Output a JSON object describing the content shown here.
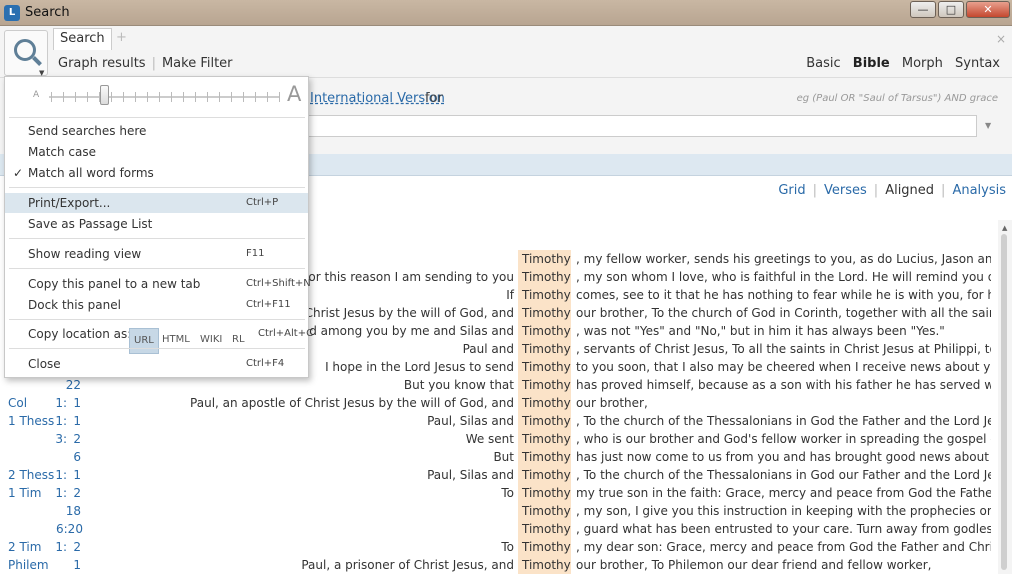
{
  "window": {
    "title": "Search",
    "app_icon": "L",
    "min": "—",
    "max": "□",
    "close": "✕"
  },
  "panel": {
    "tab": "Search",
    "add_tab": "+",
    "close": "×",
    "links": [
      "Graph results",
      "Make Filter"
    ],
    "modes": [
      "Basic",
      "Bible",
      "Morph",
      "Syntax"
    ],
    "active_mode": "Bible"
  },
  "search": {
    "version": "International Version",
    "for": "for",
    "hint": "eg (Paul OR \"Saul of Tarsus\") AND grace",
    "query": "",
    "dropdown": "▼"
  },
  "views": {
    "items": [
      "Grid",
      "Verses",
      "Aligned",
      "Analysis"
    ],
    "active": "Aligned"
  },
  "menu": {
    "slider_small": "A",
    "slider_big": "A",
    "send_here": "Send searches here",
    "match_case": "Match case",
    "match_all": "Match all word forms",
    "checkmark": "✓",
    "print": "Print/Export...",
    "print_sc": "Ctrl+P",
    "save_list": "Save as Passage List",
    "reading": "Show reading view",
    "reading_sc": "F11",
    "copy_tab": "Copy this panel to a new tab",
    "copy_tab_sc": "Ctrl+Shift+N",
    "dock": "Dock this panel",
    "dock_sc": "Ctrl+F11",
    "copy_loc": "Copy location as:",
    "formats": [
      "URL",
      "HTML",
      "WIKI",
      "RL"
    ],
    "copy_loc_sc": "Ctrl+Alt+C",
    "close": "Close",
    "close_sc": "Ctrl+F4"
  },
  "results": [
    {
      "book": "",
      "ch": "",
      "vs": "",
      "before": "",
      "match": "Timothy",
      "after": ", my fellow worker, sends his greetings to you, as do Lucius, Jason and Sosip"
    },
    {
      "book": "",
      "ch": "",
      "vs": "",
      "before": "For this reason I am sending to you",
      "match": "Timothy",
      "after": ", my son whom I love, who is faithful in the Lord. He will remind you of my w"
    },
    {
      "book": "",
      "ch": "",
      "vs": "",
      "before": "If",
      "match": "Timothy",
      "after": "comes, see to it that he has nothing to fear while he is with you, for he is ca"
    },
    {
      "book": "",
      "ch": "",
      "vs": "",
      "before": "of Christ Jesus by the will of God, and",
      "match": "Timothy",
      "after": "our brother, To the church of God in Corinth, together with all the saints thr"
    },
    {
      "book": "",
      "ch": "",
      "vs": "",
      "before": "ached among you by me and Silas and",
      "match": "Timothy",
      "after": ", was not \"Yes\" and \"No,\" but in him it has always been \"Yes.\""
    },
    {
      "book": "",
      "ch": "",
      "vs": "",
      "before": "Paul and",
      "match": "Timothy",
      "after": ", servants of Christ Jesus, To all the saints in Christ Jesus at Philippi, together"
    },
    {
      "book": "",
      "ch": "",
      "vs": "",
      "before": "I hope in the Lord Jesus to send",
      "match": "Timothy",
      "after": "to you soon, that I also may be cheered when I receive news about you."
    },
    {
      "book": "",
      "ch": "",
      "vs": "22",
      "before": "But you know that",
      "match": "Timothy",
      "after": "has proved himself, because as a son with his father he has served with me"
    },
    {
      "book": "Col",
      "ch": "1:",
      "vs": "1",
      "before": "Paul, an apostle of Christ Jesus by the will of God, and",
      "match": "Timothy",
      "after": "our brother,"
    },
    {
      "book": "1 Thess",
      "ch": "1:",
      "vs": "1",
      "before": "Paul, Silas and",
      "match": "Timothy",
      "after": ", To the church of the Thessalonians in God the Father and the Lord Jesus Ch"
    },
    {
      "book": "",
      "ch": "3:",
      "vs": "2",
      "before": "We sent",
      "match": "Timothy",
      "after": ", who is our brother and God's fellow worker in spreading the gospel of Chri"
    },
    {
      "book": "",
      "ch": "",
      "vs": "6",
      "before": "But",
      "match": "Timothy",
      "after": "has just now come to us from you and has brought good news about your f"
    },
    {
      "book": "2 Thess",
      "ch": "1:",
      "vs": "1",
      "before": "Paul, Silas and",
      "match": "Timothy",
      "after": ", To the church of the Thessalonians in God our Father and the Lord Jesus Ch"
    },
    {
      "book": "1 Tim",
      "ch": "1:",
      "vs": "2",
      "before": "To",
      "match": "Timothy",
      "after": "my true son in the faith: Grace, mercy and peace from God the Father and"
    },
    {
      "book": "",
      "ch": "",
      "vs": "18",
      "before": "",
      "match": "Timothy",
      "after": ", my son, I give you this instruction in keeping with the prophecies once mac"
    },
    {
      "book": "",
      "ch": "",
      "vs": "6:20",
      "before": "",
      "match": "Timothy",
      "after": ", guard what has been entrusted to your care. Turn away from godless chatt"
    },
    {
      "book": "2 Tim",
      "ch": "1:",
      "vs": "2",
      "before": "To",
      "match": "Timothy",
      "after": ", my dear son: Grace, mercy and peace from God the Father and Christ Jesu"
    },
    {
      "book": "Philem",
      "ch": "",
      "vs": "1",
      "before": "Paul, a prisoner of Christ Jesus, and",
      "match": "Timothy",
      "after": "our brother, To Philemon our dear friend and fellow worker,"
    }
  ]
}
